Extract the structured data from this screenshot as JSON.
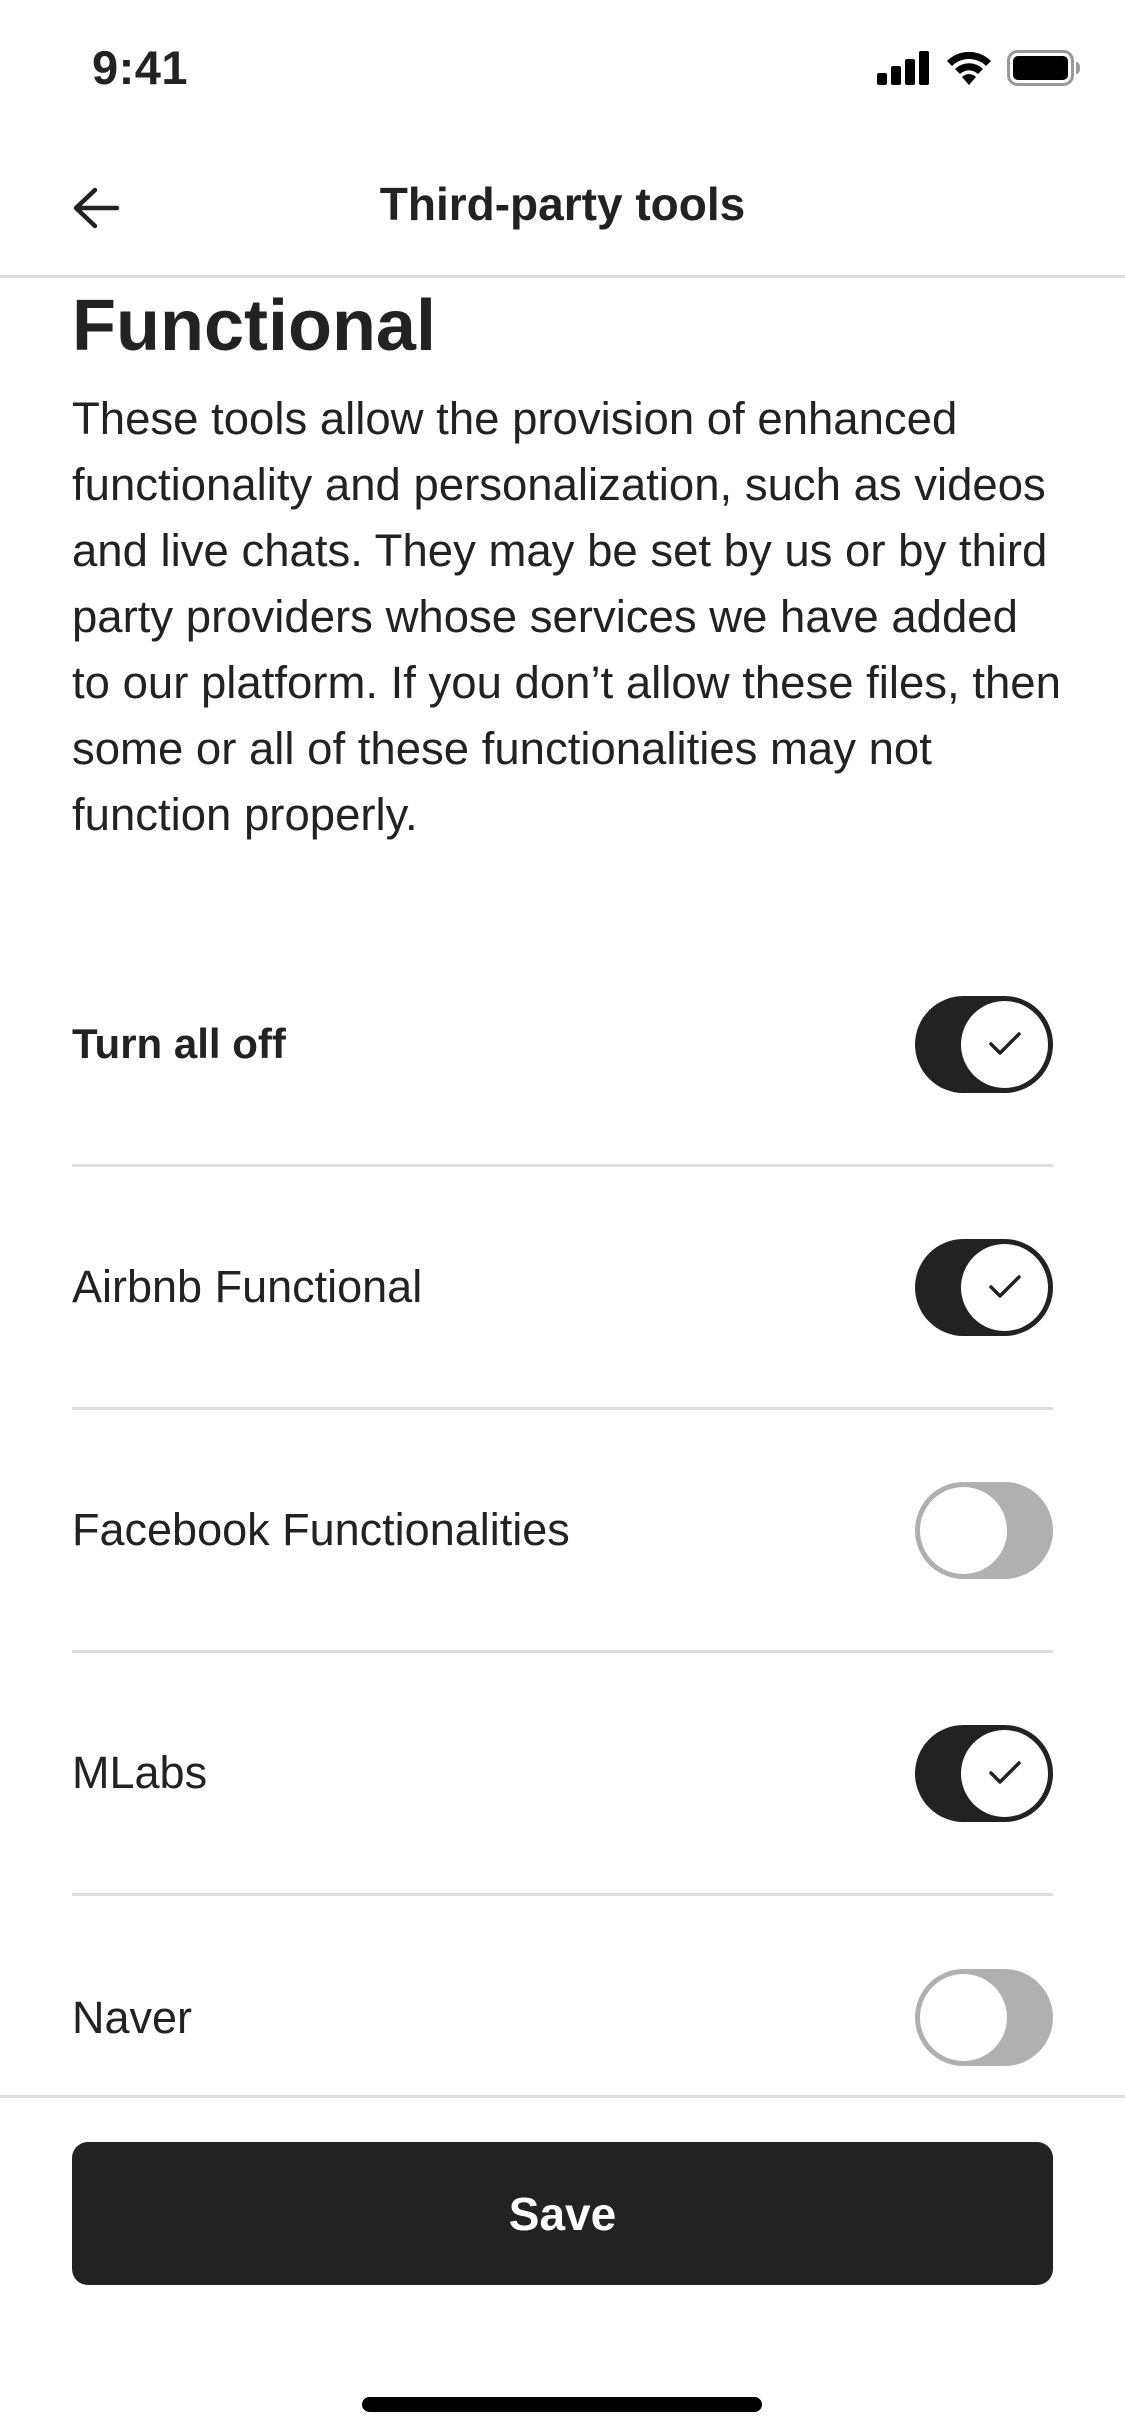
{
  "status_bar": {
    "time": "9:41",
    "icons": [
      "cellular-signal-icon",
      "wifi-icon",
      "battery-icon"
    ]
  },
  "nav": {
    "back_icon": "arrow-left-icon",
    "title": "Third-party tools"
  },
  "section": {
    "title": "Functional",
    "description": "These tools allow the provision of enhanced functionality and personalization, such as videos and live chats. They may be set by us or by third party providers whose services we have added to our platform. If you don’t allow these files, then some or all of these functionalities may not function properly."
  },
  "toggles": [
    {
      "label": "Turn all off",
      "on": true
    },
    {
      "label": "Airbnb Functional",
      "on": true
    },
    {
      "label": "Facebook Functionalities",
      "on": false
    },
    {
      "label": "MLabs",
      "on": true
    },
    {
      "label": "Naver",
      "on": false
    }
  ],
  "footer": {
    "save_label": "Save"
  },
  "colors": {
    "on": "#222222",
    "off": "#b0b0b0",
    "divider": "#dddddd",
    "text": "#222222"
  }
}
